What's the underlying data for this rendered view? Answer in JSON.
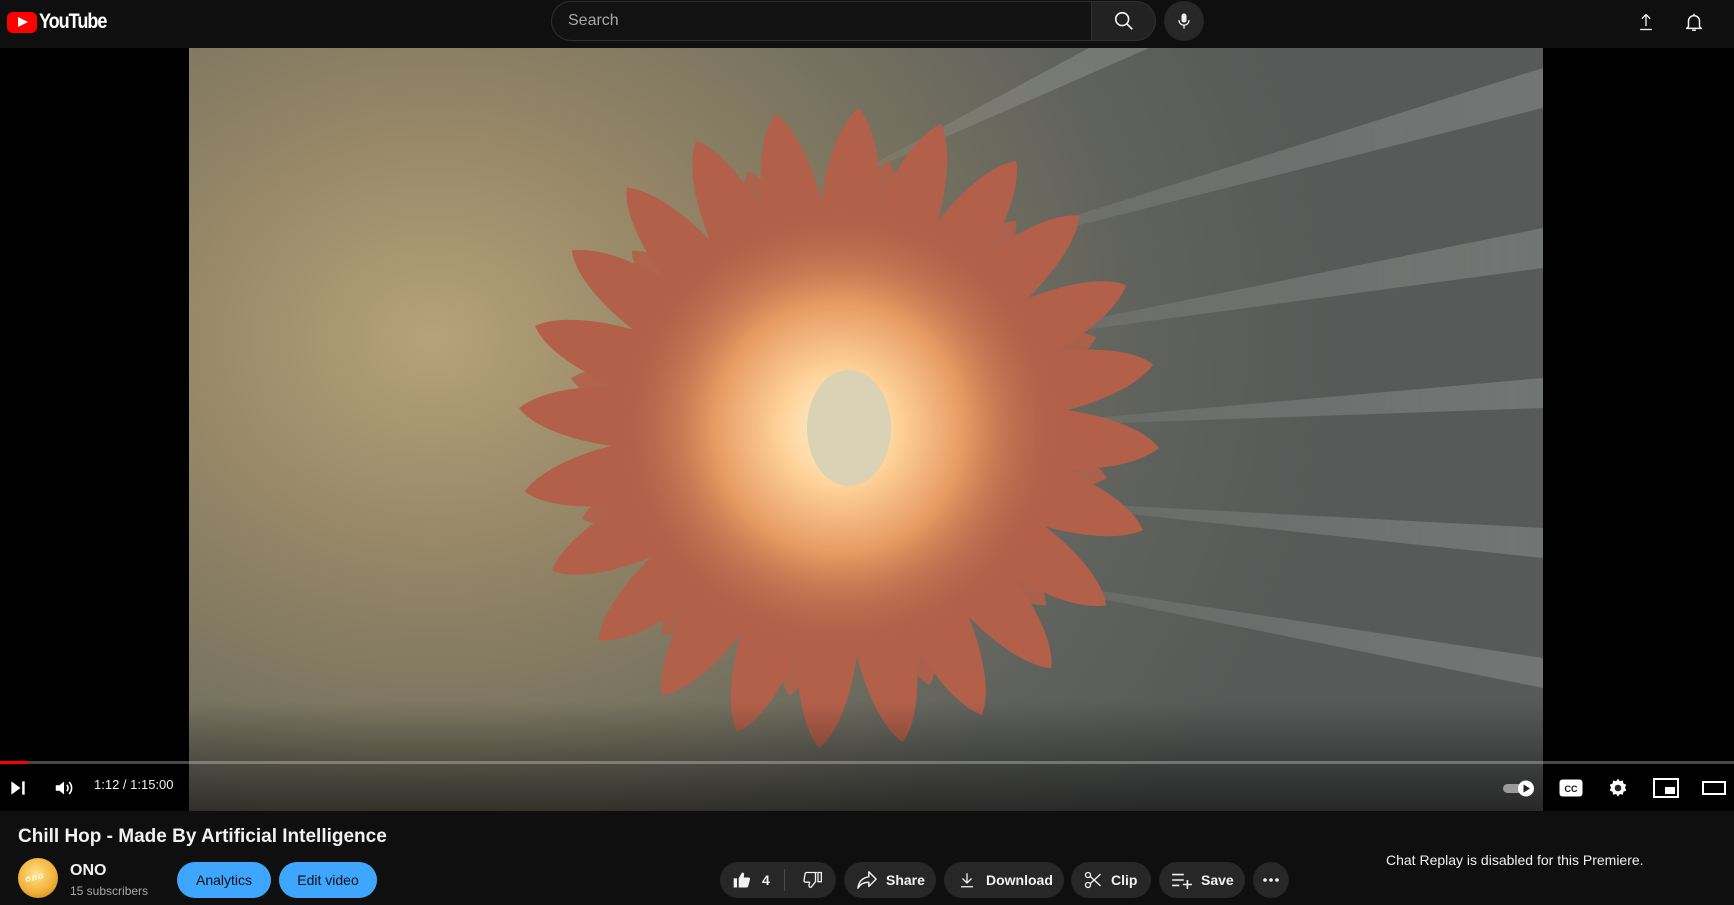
{
  "masthead": {
    "logo_text": "YouTube",
    "search_placeholder": "Search",
    "icons": [
      "youtube-logo",
      "search-icon",
      "mic-icon",
      "upload-icon",
      "bell-icon"
    ]
  },
  "player": {
    "time_display": "1:12 / 1:15:00",
    "progress_fraction": 0.016,
    "autoplay": true,
    "icons": [
      "next-icon",
      "volume-icon",
      "autoplay-toggle",
      "captions-icon",
      "settings-icon",
      "miniplayer-icon",
      "theater-icon"
    ],
    "cc_label": "CC"
  },
  "video": {
    "title": "Chill Hop - Made By Artificial Intelligence"
  },
  "channel": {
    "name": "ONO",
    "subscribers": "15 subscribers",
    "avatar_text": "ono"
  },
  "owner_buttons": {
    "analytics": "Analytics",
    "edit_video": "Edit video"
  },
  "actions": {
    "like_count": "4",
    "share": "Share",
    "download": "Download",
    "clip": "Clip",
    "save": "Save"
  },
  "chat": {
    "replay_disabled": "Chat Replay is disabled for this Premiere."
  },
  "colors": {
    "background": "#0f0f0f",
    "accent_blue": "#3ea6ff",
    "progress_red": "#ff0000",
    "pill_bg": "#272727"
  }
}
